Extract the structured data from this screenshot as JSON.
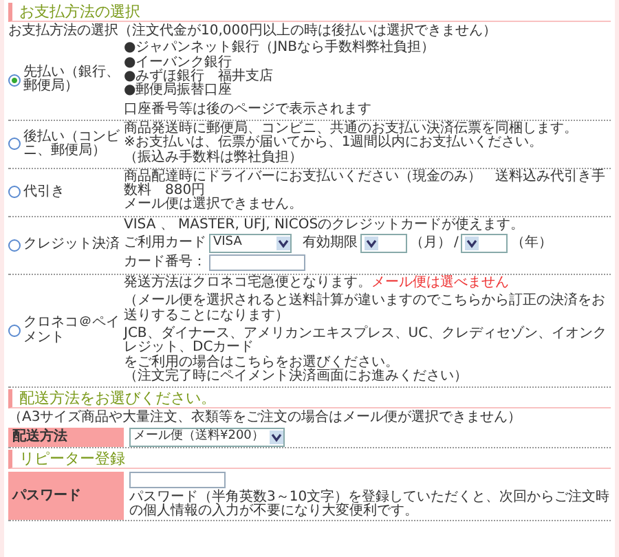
{
  "payment": {
    "heading": "お支払方法の選択",
    "note": "お支払方法の選択（注文代金が10,000円以上の時は後払いは選択できません）",
    "options": [
      {
        "kind": "text",
        "label": "先払い（銀行、郵便局）",
        "selected": true,
        "groups": [
          [
            "●ジャパンネット銀行（JNBなら手数料弊社負担）",
            "●イーバンク銀行",
            "●みずほ銀行　福井支店",
            "●郵便局振替口座"
          ],
          [
            "口座番号等は後のページで表示されます"
          ]
        ]
      },
      {
        "kind": "text",
        "label": "後払い（コンビニ、郵便局）",
        "selected": false,
        "groups": [
          [
            "商品発送時に郵便局、コンビニ、共通のお支払い決済伝票を同梱します。",
            "※お支払いは、伝票が届いてから、1週間以内にお支払いください。",
            "（振込み手数料は弊社負担）"
          ]
        ]
      },
      {
        "kind": "text",
        "label": "代引き",
        "selected": false,
        "groups": [
          [
            "商品配達時にドライバーにお支払いください（現金のみ）　送料込み代引き手数料　880円",
            "メール便は選択できません。"
          ]
        ]
      },
      {
        "kind": "card",
        "label": "クレジット決済",
        "selected": false,
        "intro": "VISA 、 MASTER, UFJ, NICOSのクレジットカードが使えます。",
        "card_label": "ご利用カード",
        "card_value": "VISA",
        "expiry_label": "有効期限",
        "month": "（月）",
        "slash": "/",
        "year": "（年）",
        "number_label": "カード番号："
      },
      {
        "kind": "warning",
        "label": "クロネコ＠ペイメント",
        "selected": false,
        "lead": "発送方法はクロネコ宅急便となります。",
        "warning": "メール便は選べません",
        "groups": [
          [
            "（メール便を選択されると送料計算が違いますのでこちらから訂正の決済をお送りすることになります）"
          ],
          [
            "JCB、ダイナース、アメリカンエキスプレス、UC、クレディセゾン、イオンクレジット、DCカード",
            "をご利用の場合はこちらをお選びください。",
            "（注文完了時にペイメント決済画面にお進みください）"
          ]
        ]
      }
    ]
  },
  "delivery": {
    "heading": "配送方法をお選びください。",
    "note": "（A3サイズ商品や大量注文、衣類等をご注文の場合はメール便が選択できません）",
    "label": "配送方法",
    "value": "メール便（送料¥200）"
  },
  "repeater": {
    "heading": "リピーター登録",
    "label": "パスワード",
    "hint": "パスワード（半角英数3～10文字）を登録していただくと、次回からご注文時の個人情報の入力が不要になり大変便利です。"
  }
}
